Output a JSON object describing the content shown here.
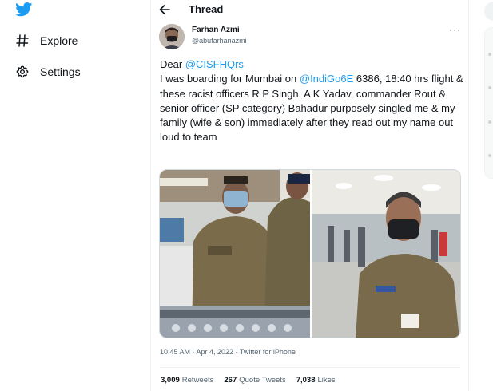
{
  "nav": {
    "logo_icon": "twitter-bird-icon",
    "items": [
      {
        "label": "Explore",
        "icon": "hashtag-icon"
      },
      {
        "label": "Settings",
        "icon": "gear-icon"
      }
    ]
  },
  "thread": {
    "title": "Thread",
    "back_icon": "arrow-left-icon"
  },
  "tweet": {
    "author_name": "Farhan Azmi",
    "author_handle": "@abufarhanazmi",
    "more_label": "···",
    "text": {
      "greeting": "Dear ",
      "mention1": "@CISFHQrs",
      "part1": "I was boarding for Mumbai on ",
      "mention2": "@IndiGo6E",
      "part2": " 6386, 18:40 hrs flight & these racist officers R P Singh, A K Yadav, commander Rout & senior officer (SP category) Bahadur purposely singled me & my family (wife & son) immediately after they read out my name out loud to team"
    },
    "meta": "10:45 AM · Apr 4, 2022 · Twitter for iPhone",
    "stats": [
      {
        "count": "3,009",
        "label": "Retweets"
      },
      {
        "count": "267",
        "label": "Quote Tweets"
      },
      {
        "count": "7,038",
        "label": "Likes"
      }
    ]
  },
  "colors": {
    "accent": "#1d9bf0",
    "text": "#0f1419",
    "muted": "#536471",
    "border": "#eff3f4"
  }
}
